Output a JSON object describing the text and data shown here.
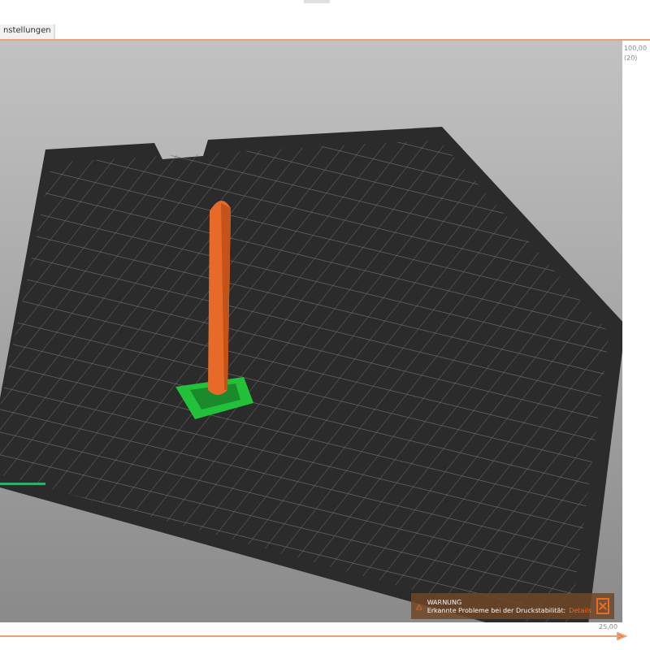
{
  "tabs": [
    {
      "label": "nstellungen",
      "selected": true
    }
  ],
  "vertical_slider": {
    "top_label": "100,00",
    "top_sub_label": "(20)"
  },
  "horizontal_slider": {
    "end_label": "25,00",
    "level": 1
  },
  "warning": {
    "title": "WARNUNG",
    "message": "Erkannte Probleme bei der Druckstabilität:",
    "link": "Details"
  }
}
